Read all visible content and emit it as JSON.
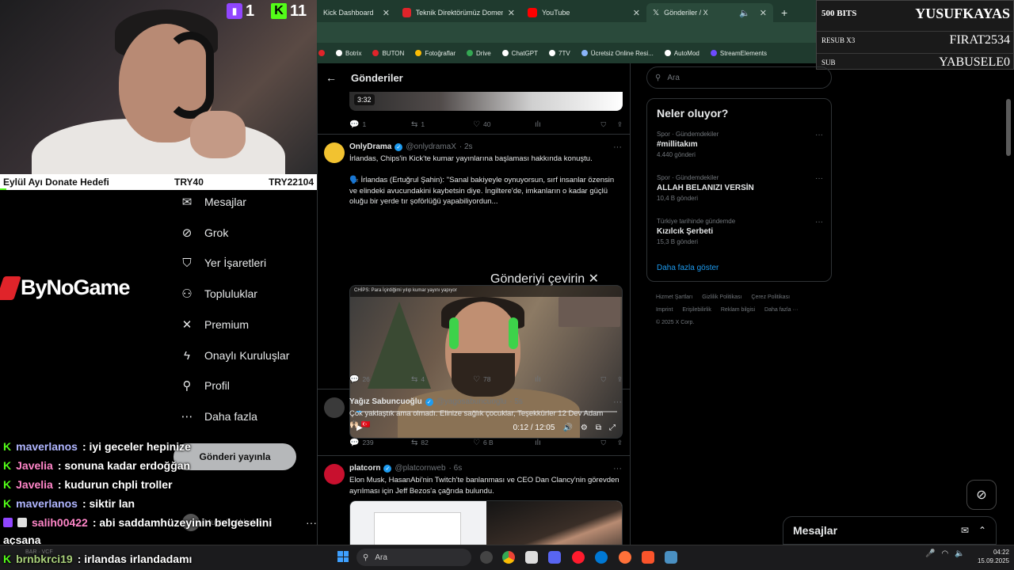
{
  "stream": {
    "twitch_count": "1",
    "kick_count": "11",
    "goal_label": "Eylül Ayı Donate Hedefi",
    "goal_current": "TRY40",
    "goal_target": "TRY22104",
    "sponsor": "ByNoGame"
  },
  "alerts": {
    "row1_label": "500 BITS",
    "row1_user": "YUSUFKAYAS",
    "row2_label": "RESUB X3",
    "row2_user": "FIRAT2534",
    "row3_label": "SUB",
    "row3_user": "YABUSELE0"
  },
  "browser": {
    "tabs": [
      {
        "label": "Kick Dashboard",
        "color": "#53fc18"
      },
      {
        "label": "Teknik Direktörümüz Domenico",
        "color": "#e0242a"
      },
      {
        "label": "YouTube",
        "color": "#ff0000"
      },
      {
        "label": "Gönderiler / X",
        "color": "#ffffff"
      }
    ],
    "new_tab": "+",
    "bookmarks": [
      {
        "label": "Botrix",
        "color": "#ffffff"
      },
      {
        "label": "BUTON",
        "color": "#e0242a"
      },
      {
        "label": "Fotoğraflar",
        "color": "#fbbc05"
      },
      {
        "label": "Drive",
        "color": "#34a853"
      },
      {
        "label": "ChatGPT",
        "color": "#ffffff"
      },
      {
        "label": "7TV",
        "color": "#ffffff"
      },
      {
        "label": "Ücretsiz Online Resi...",
        "color": "#8ab4f8"
      },
      {
        "label": "AutoMod",
        "color": "#ffffff"
      },
      {
        "label": "StreamElements",
        "color": "#6e4bff"
      }
    ]
  },
  "nav": {
    "items": [
      {
        "label": "Mesajlar",
        "icon": "✉"
      },
      {
        "label": "Grok",
        "icon": "⊘"
      },
      {
        "label": "Yer İşaretleri",
        "icon": "⛉"
      },
      {
        "label": "Topluluklar",
        "icon": "⚇"
      },
      {
        "label": "Premium",
        "icon": "✕"
      },
      {
        "label": "Onaylı Kuruluşlar",
        "icon": "ϟ"
      },
      {
        "label": "Profil",
        "icon": "⚲"
      },
      {
        "label": "Daha fazla",
        "icon": "⋯"
      }
    ],
    "post_button": "Gönderi yayınla",
    "account_name": "Mustafa Akbaba"
  },
  "chat": [
    {
      "platform": "kick",
      "user": "maverlanos",
      "message": ": iyi geceler hepinize"
    },
    {
      "platform": "kick",
      "user": "Javelia",
      "message": ": sonuna kadar erdoğğan"
    },
    {
      "platform": "kick",
      "user": "Javelia",
      "message": ": kudurun chpli troller"
    },
    {
      "platform": "kick",
      "user": "maverlanos",
      "message": ": siktir lan"
    },
    {
      "platform": "twitch",
      "user": "salih00422",
      "message": ": abi saddamhüzeyinin belgeselini"
    },
    {
      "platform": "twitch",
      "user": "",
      "message": "açsana"
    },
    {
      "platform": "kick",
      "user": "brnbkrci19",
      "message": ": irlandas irlandadamı"
    }
  ],
  "main": {
    "title": "Gönderiler",
    "top_post": {
      "duration": "3:32",
      "replies": "1",
      "reposts": "1",
      "likes": "40"
    },
    "posts": [
      {
        "name": "OnlyDrama",
        "handle": "@onlydramaX",
        "time": "· 2s",
        "avatar_color": "#f2c230",
        "text1": "İrlandas, Chips'in Kick'te kumar yayınlarına başlaması hakkında konuştu.",
        "text2": "🗣️ İrlandas (Ertuğrul Şahin): \"Sanal bakiyeyle oynuyorsun, sırf insanlar özensin ve elindeki avucundakini kaybetsin diye. İngiltere'de, imkanların o kadar güçlü oluğu bir yerde tır şoförlüğü yapabiliyordun...",
        "video_caption": "CHİPS: Para İçirdiğimi yılıp kumar yayını yapıyor",
        "video_time": "0:12 / 12:05",
        "video_progress": 0.017,
        "translate": "Gönderiyi çevirin",
        "replies": "26",
        "reposts": "4",
        "likes": "78"
      },
      {
        "name": "Yağız Sabuncuoğlu",
        "handle": "@yagosabuncuoglu",
        "time": "· 5s",
        "avatar_color": "#3a3a3a",
        "text1": "Çok yaklaştık ama olmadı. Elinize sağlık çocuklar, Teşekkürler 12 Dev Adam",
        "text2": "🙌🏻 🇹🇷",
        "replies": "239",
        "reposts": "82",
        "likes": "6 B"
      },
      {
        "name": "platcorn",
        "handle": "@platcornweb",
        "time": "· 6s",
        "avatar_color": "#c8102e",
        "text1": "Elon Musk, HasanAbi'nin Twitch'te banlanması ve CEO Dan Clancy'nin görevden ayrılması için Jeff Bezos'a çağrıda bulundu."
      }
    ]
  },
  "sidebar": {
    "search_placeholder": "Ara",
    "trends_title": "Neler oluyor?",
    "trends": [
      {
        "category": "Spor · Gündemdekiler",
        "title": "#millitakım",
        "count": "4.440 gönderi"
      },
      {
        "category": "Spor · Gündemdekiler",
        "title": "ALLAH BELANIZI VERSİN",
        "count": "10,4 B gönderi"
      },
      {
        "category": "Türkiye tarihinde gündemde",
        "title": "Kızılcık Şerbeti",
        "count": "15,3 B gönderi"
      }
    ],
    "show_more": "Daha fazla göster",
    "footer": [
      "Hizmet Şartları",
      "Gizlilik Politikası",
      "Çerez Politikası",
      "Imprint",
      "Erişilebilirlik",
      "Reklam bilgisi",
      "Daha fazla ···",
      "© 2025 X Corp."
    ],
    "dm_title": "Mesajlar"
  },
  "taskbar": {
    "search": "Ara",
    "time": "04:22",
    "date": "15.09.2025",
    "ghost": "BAR · VCF"
  }
}
